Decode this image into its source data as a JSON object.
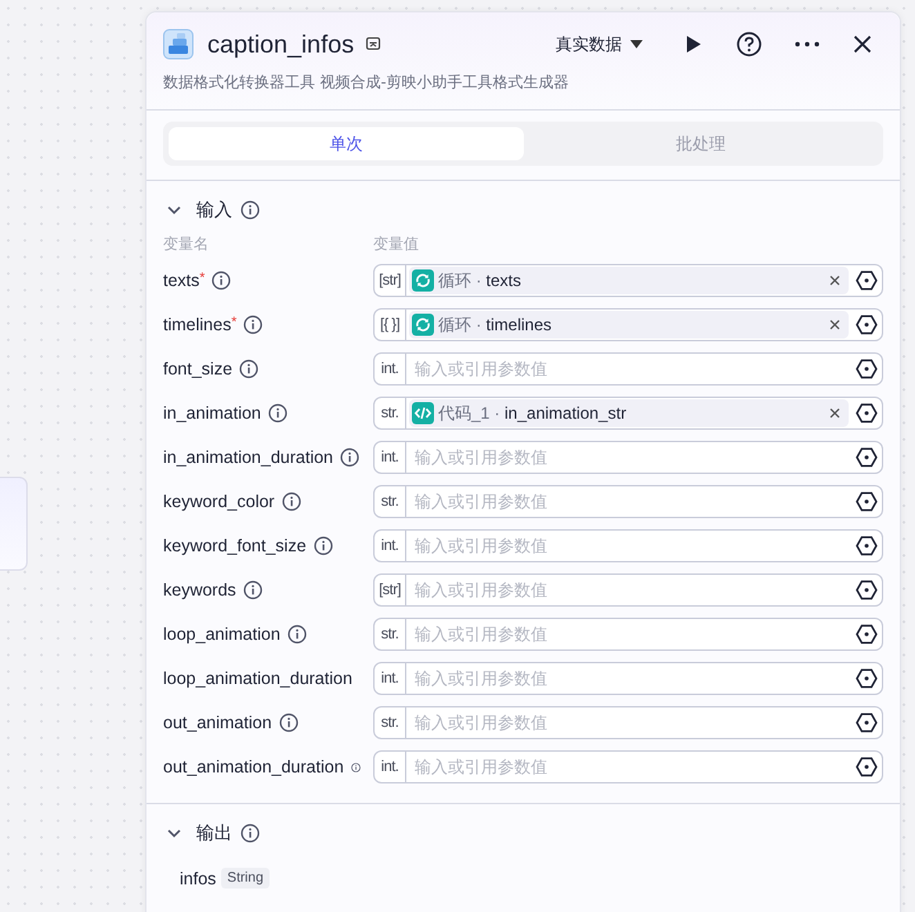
{
  "node": {
    "title": "caption_infos",
    "description": "数据格式化转换器工具 视频合成-剪映小助手工具格式生成器",
    "data_mode": "真实数据"
  },
  "tabs": [
    {
      "label": "单次",
      "selected": true
    },
    {
      "label": "批处理",
      "selected": false
    }
  ],
  "input": {
    "title": "输入",
    "expanded": true,
    "name_header": "变量名",
    "value_header": "变量值",
    "required_mark": "*",
    "params": [
      {
        "name": "texts",
        "required": true,
        "info": true,
        "type": "[str]",
        "ref": {
          "kind": "loop",
          "source": "循环 ·",
          "variable": "texts"
        }
      },
      {
        "name": "timelines",
        "required": true,
        "info": true,
        "type": "[{ }]",
        "ref": {
          "kind": "loop",
          "source": "循环 ·",
          "variable": "timelines"
        }
      },
      {
        "name": "font_size",
        "required": false,
        "info": true,
        "type": "int.",
        "placeholder": "输入或引用参数值"
      },
      {
        "name": "in_animation",
        "required": false,
        "info": true,
        "type": "str.",
        "ref": {
          "kind": "code",
          "source": "代码_1 ·",
          "variable": "in_animation_str"
        }
      },
      {
        "name": "in_animation_duration",
        "required": false,
        "info": true,
        "type": "int.",
        "placeholder": "输入或引用参数值"
      },
      {
        "name": "keyword_color",
        "required": false,
        "info": true,
        "type": "str.",
        "placeholder": "输入或引用参数值"
      },
      {
        "name": "keyword_font_size",
        "required": false,
        "info": true,
        "type": "int.",
        "placeholder": "输入或引用参数值"
      },
      {
        "name": "keywords",
        "required": false,
        "info": true,
        "type": "[str]",
        "placeholder": "输入或引用参数值"
      },
      {
        "name": "loop_animation",
        "required": false,
        "info": true,
        "type": "str.",
        "placeholder": "输入或引用参数值"
      },
      {
        "name": "loop_animation_duration",
        "required": false,
        "info": false,
        "type": "int.",
        "placeholder": "输入或引用参数值"
      },
      {
        "name": "out_animation",
        "required": false,
        "info": true,
        "type": "str.",
        "placeholder": "输入或引用参数值"
      },
      {
        "name": "out_animation_duration",
        "required": false,
        "info": true,
        "type": "int.",
        "placeholder": "输入或引用参数值"
      }
    ]
  },
  "output": {
    "title": "输出",
    "expanded": true,
    "fields": [
      {
        "name": "infos",
        "type": "String"
      }
    ]
  }
}
